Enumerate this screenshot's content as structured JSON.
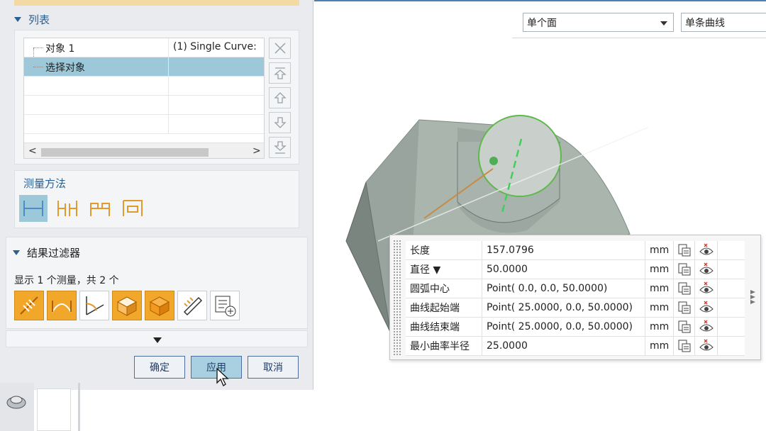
{
  "list_section": {
    "title": "列表",
    "rows": [
      {
        "name": "对象 1",
        "value": "(1) Single Curve:"
      },
      {
        "name": "选择对象",
        "value": ""
      },
      {
        "name": "",
        "value": ""
      },
      {
        "name": "",
        "value": ""
      },
      {
        "name": "",
        "value": ""
      }
    ],
    "scroll_left": "<",
    "scroll_right": ">"
  },
  "method_section": {
    "title": "测量方法"
  },
  "result_filter": {
    "title": "结果过滤器",
    "summary": "显示 1 个测量，共 2 个"
  },
  "buttons": {
    "ok": "确定",
    "apply": "应用",
    "cancel": "取消"
  },
  "viewport": {
    "face_select": "单个面",
    "curve_select": "单条曲线"
  },
  "results": {
    "rows": [
      {
        "name": "长度",
        "value": "157.0796",
        "unit": "mm"
      },
      {
        "name": "直径 ▼",
        "value": "50.0000",
        "unit": "mm"
      },
      {
        "name": "圆弧中心",
        "value": "Point( 0.0, 0.0, 50.0000)",
        "unit": "mm"
      },
      {
        "name": "曲线起始端",
        "value": "Point( 25.0000, 0.0, 50.0000)",
        "unit": "mm"
      },
      {
        "name": "曲线结束端",
        "value": "Point( 25.0000, 0.0, 50.0000)",
        "unit": "mm"
      },
      {
        "name": "最小曲率半径",
        "value": "25.0000",
        "unit": "mm"
      }
    ]
  },
  "colors": {
    "accent": "#2d5f8f",
    "selection": "#9dc8d9",
    "filter_orange": "#f0a72a"
  }
}
